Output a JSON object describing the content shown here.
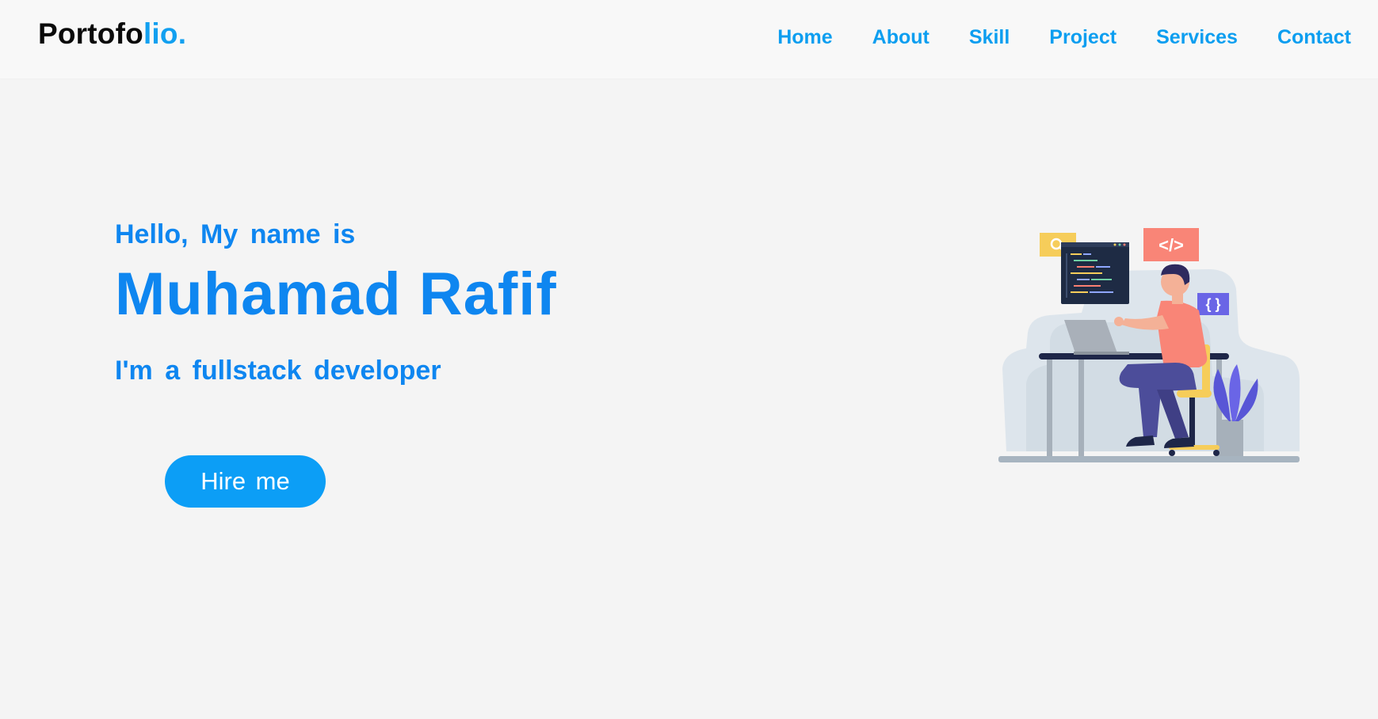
{
  "brand": {
    "logo_main": "Portofo",
    "logo_accent": "lio."
  },
  "nav": {
    "items": [
      {
        "label": "Home"
      },
      {
        "label": "About"
      },
      {
        "label": "Skill"
      },
      {
        "label": "Project"
      },
      {
        "label": "Services"
      },
      {
        "label": "Contact"
      }
    ]
  },
  "hero": {
    "greeting": "Hello, My name is",
    "name": "Muhamad Rafif",
    "role": "I'm a fullstack developer",
    "cta_label": "Hire me"
  },
  "illustration": {
    "code_tag": "</>",
    "braces_tag": "{ }",
    "icon": "search-icon"
  },
  "colors": {
    "accent": "#0c9ef0",
    "heading_blue": "#0e86f0",
    "button": "#0c9ef6",
    "background": "#f4f4f4",
    "navbar": "#f8f8f8"
  }
}
